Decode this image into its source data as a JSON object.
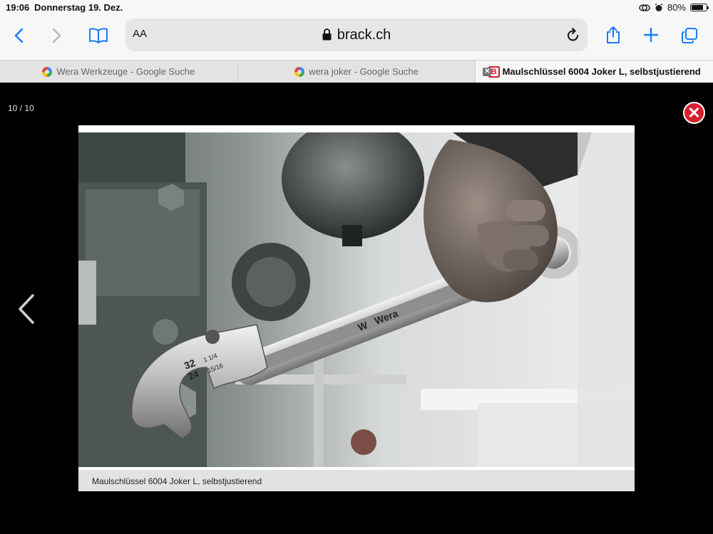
{
  "status": {
    "time": "19:06",
    "date": "Donnerstag 19. Dez.",
    "battery": "80%",
    "battery_level": 0.8
  },
  "toolbar": {
    "text_size_label": "AA",
    "url": "brack.ch",
    "icons": [
      "back-icon",
      "forward-icon",
      "bookmarks-icon",
      "lock-icon",
      "reload-icon",
      "share-icon",
      "new-tab-icon",
      "tabs-icon"
    ]
  },
  "tabs": [
    {
      "title": "Wera Werkzeuge - Google Suche",
      "favicon": "google-icon"
    },
    {
      "title": "wera joker - Google Suche",
      "favicon": "google-icon"
    },
    {
      "title": "Maulschlüssel 6004 Joker L, selbstjustierend",
      "favicon": "brack-icon",
      "active": true
    }
  ],
  "brack_favicon_letter": "B",
  "lightbox": {
    "counter": "10 / 10",
    "caption": "Maulschlüssel 6004 Joker L, selbstjustierend",
    "image_text": {
      "brand": "Wera",
      "size_large": "32",
      "size_small": "24",
      "inch_top": "1 1/4",
      "inch_bottom": "15/16"
    }
  },
  "colors": {
    "accent": "#1a7cf5",
    "close_red": "#d7202d",
    "brand_red": "#d0202e"
  }
}
